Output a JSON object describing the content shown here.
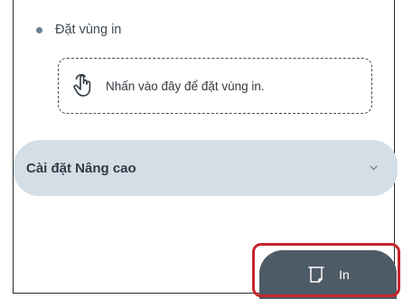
{
  "print_area": {
    "heading": "Đặt vùng in",
    "tap_hint": "Nhấn vào đây để đặt vùng in.",
    "icons": {
      "bullet": "bullet-dot",
      "tap": "hand-pointer-icon"
    }
  },
  "advanced_settings": {
    "label": "Cài đặt Nâng cao",
    "expanded": false,
    "icon": "chevron-down-icon"
  },
  "print_button": {
    "label": "In",
    "icon": "paper-print-icon"
  },
  "colors": {
    "accordion_bg": "#d3dee6",
    "button_bg": "#4d5b66",
    "highlight": "#c8242b"
  }
}
